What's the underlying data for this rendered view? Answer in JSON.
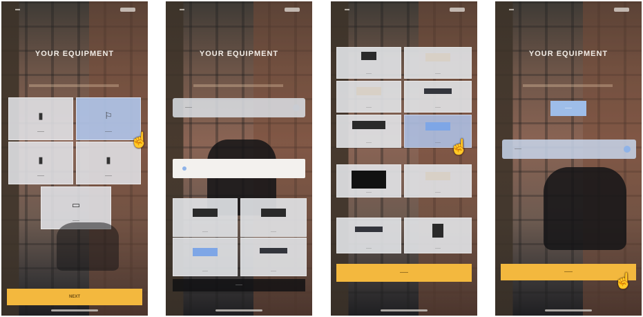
{
  "screens": [
    {
      "title": "YOUR EQUIPMENT",
      "cards": [
        {
          "label": "——",
          "icon": "▮"
        },
        {
          "label": "——",
          "icon": "⚐"
        },
        {
          "label": "——",
          "icon": "▮"
        },
        {
          "label": "——",
          "icon": "▮"
        },
        {
          "label": "——",
          "icon": "▭"
        }
      ],
      "cta": "NEXT"
    },
    {
      "title": "YOUR EQUIPMENT",
      "select": "——",
      "brands": [
        "——",
        "——",
        "——",
        "——"
      ],
      "footer": "——"
    },
    {
      "brands": [
        "——",
        "——",
        "——",
        "——",
        "——",
        "——",
        "——",
        "——",
        "——",
        "——"
      ],
      "cta": "——"
    },
    {
      "title": "YOUR EQUIPMENT",
      "chip": "——",
      "select": "——",
      "cta": "——"
    }
  ],
  "colors": {
    "accent": "#f3b83e",
    "highlight": "#b0c6ec"
  }
}
